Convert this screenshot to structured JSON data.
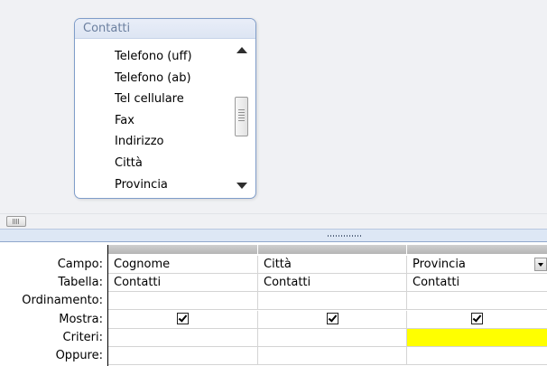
{
  "table_box": {
    "title": "Contatti",
    "fields": [
      "Telefono (uff)",
      "Telefono (ab)",
      "Tel cellulare",
      "Fax",
      "Indirizzo",
      "Città",
      "Provincia"
    ]
  },
  "grid": {
    "row_labels": [
      "Campo:",
      "Tabella:",
      "Ordinamento:",
      "Mostra:",
      "Criteri:",
      "Oppure:"
    ],
    "columns": [
      {
        "field": "Cognome",
        "table": "Contatti",
        "sort": "",
        "show": true,
        "criteria": ""
      },
      {
        "field": "Città",
        "table": "Contatti",
        "sort": "",
        "show": true,
        "criteria": ""
      },
      {
        "field": "Provincia",
        "table": "Contatti",
        "sort": "",
        "show": true,
        "criteria": ""
      }
    ],
    "highlight_color": "#ffff00"
  }
}
